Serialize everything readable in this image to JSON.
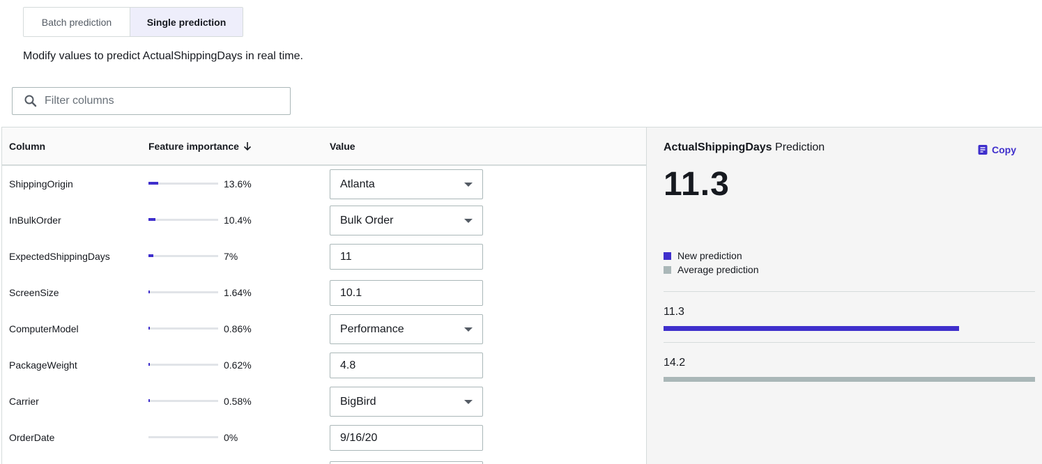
{
  "tabs": {
    "batch_label": "Batch prediction",
    "single_label": "Single prediction",
    "active": "Single prediction"
  },
  "subtitle": "Modify values to predict ActualShippingDays in real time.",
  "search": {
    "placeholder": "Filter columns",
    "value": ""
  },
  "table": {
    "headers": {
      "column": "Column",
      "importance": "Feature importance",
      "value": "Value"
    },
    "rows": [
      {
        "name": "ShippingOrigin",
        "importance_pct": "13.6%",
        "importance": 13.6,
        "value": "Atlanta",
        "type": "select"
      },
      {
        "name": "InBulkOrder",
        "importance_pct": "10.4%",
        "importance": 10.4,
        "value": "Bulk Order",
        "type": "select"
      },
      {
        "name": "ExpectedShippingDays",
        "importance_pct": "7%",
        "importance": 7,
        "value": "11",
        "type": "input"
      },
      {
        "name": "ScreenSize",
        "importance_pct": "1.64%",
        "importance": 1.64,
        "value": "10.1",
        "type": "input"
      },
      {
        "name": "ComputerModel",
        "importance_pct": "0.86%",
        "importance": 0.86,
        "value": "Performance",
        "type": "select"
      },
      {
        "name": "PackageWeight",
        "importance_pct": "0.62%",
        "importance": 0.62,
        "value": "4.8",
        "type": "input"
      },
      {
        "name": "Carrier",
        "importance_pct": "0.58%",
        "importance": 0.58,
        "value": "BigBird",
        "type": "select"
      },
      {
        "name": "OrderDate",
        "importance_pct": "0%",
        "importance": 0,
        "value": "9/16/20",
        "type": "input"
      }
    ]
  },
  "prediction": {
    "target": "ActualShippingDays",
    "title_suffix": "Prediction",
    "copy_label": "Copy",
    "value": "11.3",
    "legend": {
      "new": "New prediction",
      "average": "Average prediction"
    },
    "new_value": "11.3",
    "average_value": "14.2",
    "new_numeric": 11.3,
    "average_numeric": 14.2
  },
  "colors": {
    "accent": "#3f2fcc",
    "average": "#aab7b8",
    "tab_active_bg": "#eeeefb"
  }
}
